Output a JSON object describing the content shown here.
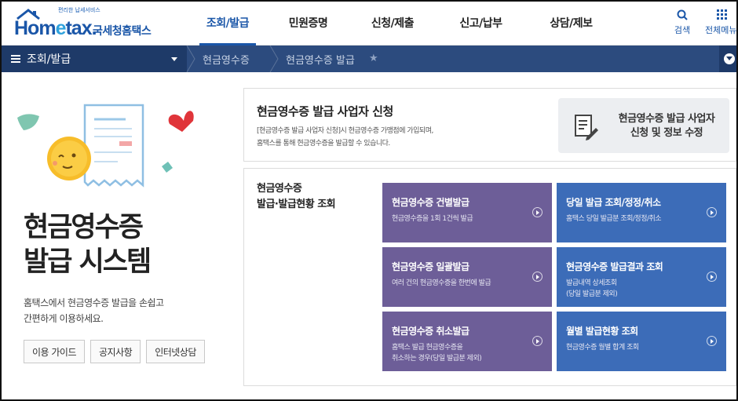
{
  "header": {
    "logo_tagline": "편리한 납세서비스",
    "logo_text_a": "Hom",
    "logo_text_e": "e",
    "logo_text_b": "tax.",
    "logo_kor": "국세청홈택스",
    "nav": [
      "조회/발급",
      "민원증명",
      "신청/제출",
      "신고/납부",
      "상담/제보"
    ],
    "active_nav": "조회/발급",
    "search_label": "검색",
    "allmenu_label": "전체메뉴"
  },
  "breadcrumb": {
    "menu_label": "조회/발급",
    "items": [
      "현금영수증",
      "현금영수증 발급"
    ]
  },
  "hero": {
    "title_line1": "현금영수증",
    "title_line2": "발급 시스템",
    "desc_line1": "홈택스에서 현금영수증 발급을 손쉽고",
    "desc_line2": "간편하게 이용하세요.",
    "buttons": [
      "이용 가이드",
      "공지사항",
      "인터넷상담"
    ]
  },
  "panel1": {
    "title": "현금영수증 발급 사업자 신청",
    "desc_line1": "[현금영수증 발급 사업자 신청]시 현금영수증 가맹점에 가입되며,",
    "desc_line2": "홈택스를 통해 현금영수증을 발급할 수 있습니다.",
    "button_line1": "현금영수증 발급 사업자",
    "button_line2": "신청 및 정보 수정"
  },
  "panel2": {
    "title_line1": "현금영수증",
    "title_line2": "발급·발급현황 조회",
    "tiles": [
      {
        "title": "현금영수증 건별발급",
        "sub1": "현금영수증을 1회 1건씩 발급",
        "sub2": ""
      },
      {
        "title": "당일 발급 조회/정정/취소",
        "sub1": "홈택스 당일 발급분 조회/정정/취소",
        "sub2": ""
      },
      {
        "title": "현금영수증 일괄발급",
        "sub1": "여러 건의 현금영수증을 한번에 발급",
        "sub2": ""
      },
      {
        "title": "현금영수증 발급결과 조회",
        "sub1": "발급내역 상세조회",
        "sub2": "(당일 발급분 제외)"
      },
      {
        "title": "현금영수증 취소발급",
        "sub1": "홈택스 발급 현금영수증을",
        "sub2": "취소하는 경우(당일 발급분 제외)"
      },
      {
        "title": "월별 발급현황 조회",
        "sub1": "현금영수증 월별 합계 조회",
        "sub2": ""
      }
    ]
  },
  "colors": {
    "brand_blue": "#1a56a8",
    "breadcrumb_bg": "#2c4b7e",
    "tile_purple": "#6d5e98",
    "tile_blue": "#3c6cb8"
  }
}
